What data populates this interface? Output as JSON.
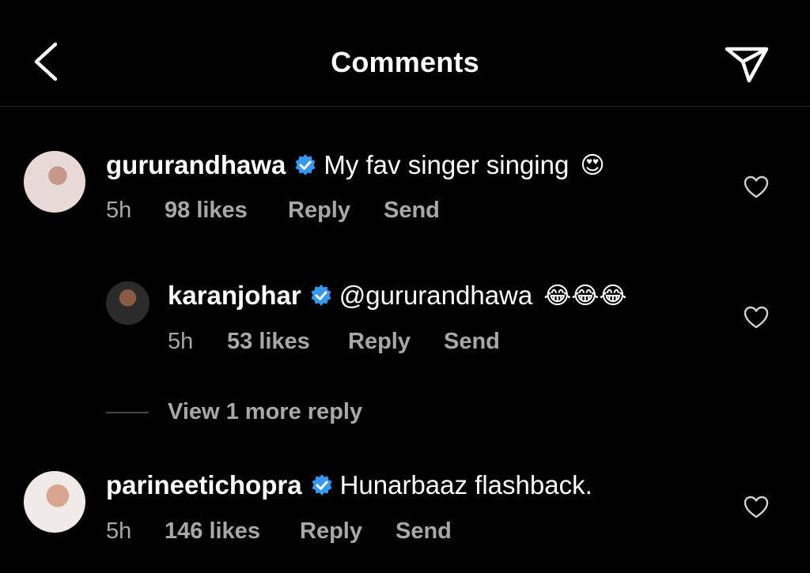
{
  "header": {
    "title": "Comments"
  },
  "colors": {
    "verified": "#3897f0",
    "secondary_text": "#a8a8a8"
  },
  "comments": [
    {
      "username": "gururandhawa",
      "text": "My fav singer singing",
      "emoji": "😍",
      "time": "5h",
      "likes": "98 likes",
      "reply": "Reply",
      "send": "Send"
    },
    {
      "username": "karanjohar",
      "text": "@gururandhawa",
      "emoji": "😂😂😂",
      "time": "5h",
      "likes": "53 likes",
      "reply": "Reply",
      "send": "Send"
    },
    {
      "username": "parineetichopra",
      "text": "Hunarbaaz flashback.",
      "emoji": "",
      "time": "5h",
      "likes": "146 likes",
      "reply": "Reply",
      "send": "Send"
    }
  ],
  "view_more": "View 1 more reply"
}
